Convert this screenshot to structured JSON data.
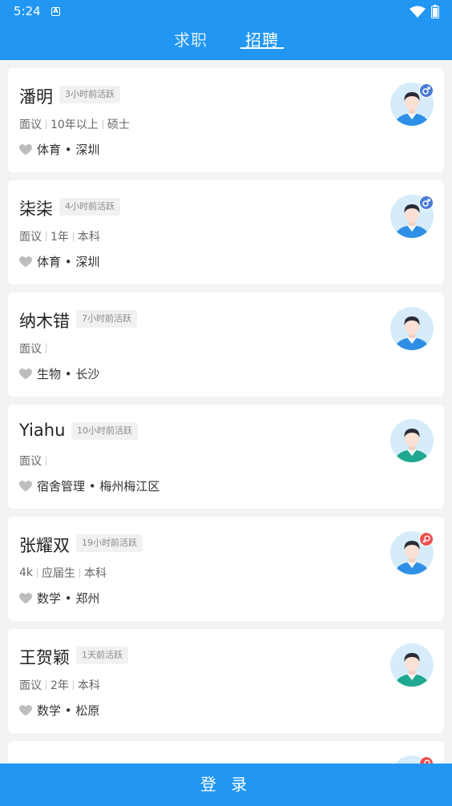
{
  "status_bar": {
    "time": "5:24",
    "notification_icon": "a-letter-icon"
  },
  "tabs": [
    {
      "label": "求职",
      "active": false
    },
    {
      "label": "招聘",
      "active": true
    }
  ],
  "candidates": [
    {
      "name": "潘明",
      "active": "3小时前活跃",
      "salary": "面议",
      "experience": "10年以上",
      "education": "硕士",
      "tags": "体育 • 深圳",
      "gender": "male",
      "shirt_color": "#2f8fe6"
    },
    {
      "name": "柒柒",
      "active": "4小时前活跃",
      "salary": "面议",
      "experience": "1年",
      "education": "本科",
      "tags": "体育 • 深圳",
      "gender": "male",
      "shirt_color": "#2f8fe6"
    },
    {
      "name": "纳木错",
      "active": "7小时前活跃",
      "salary": "面议",
      "experience": "",
      "education": "",
      "tags": "生物 • 长沙",
      "gender": "",
      "shirt_color": "#2f8fe6"
    },
    {
      "name": "Yiahu",
      "active": "10小时前活跃",
      "salary": "面议",
      "experience": "",
      "education": "",
      "tags": "宿舍管理 • 梅州梅江区",
      "gender": "",
      "shirt_color": "#1fa98f"
    },
    {
      "name": "张耀双",
      "active": "19小时前活跃",
      "salary": "4k",
      "experience": "应届生",
      "education": "本科",
      "tags": "数学 • 郑州",
      "gender": "female",
      "shirt_color": "#2f8fe6"
    },
    {
      "name": "王贺颖",
      "active": "1天前活跃",
      "salary": "面议",
      "experience": "2年",
      "education": "本科",
      "tags": "数学 • 松原",
      "gender": "",
      "shirt_color": "#1fa98f"
    },
    {
      "name": "",
      "active": "",
      "salary": "",
      "experience": "",
      "education": "",
      "tags": "",
      "gender": "female",
      "shirt_color": "#2f8fe6"
    }
  ],
  "login_label": "登 录",
  "colors": {
    "primary": "#2196f3",
    "male_badge": "#4a7bd8",
    "female_badge": "#f04e4e"
  }
}
